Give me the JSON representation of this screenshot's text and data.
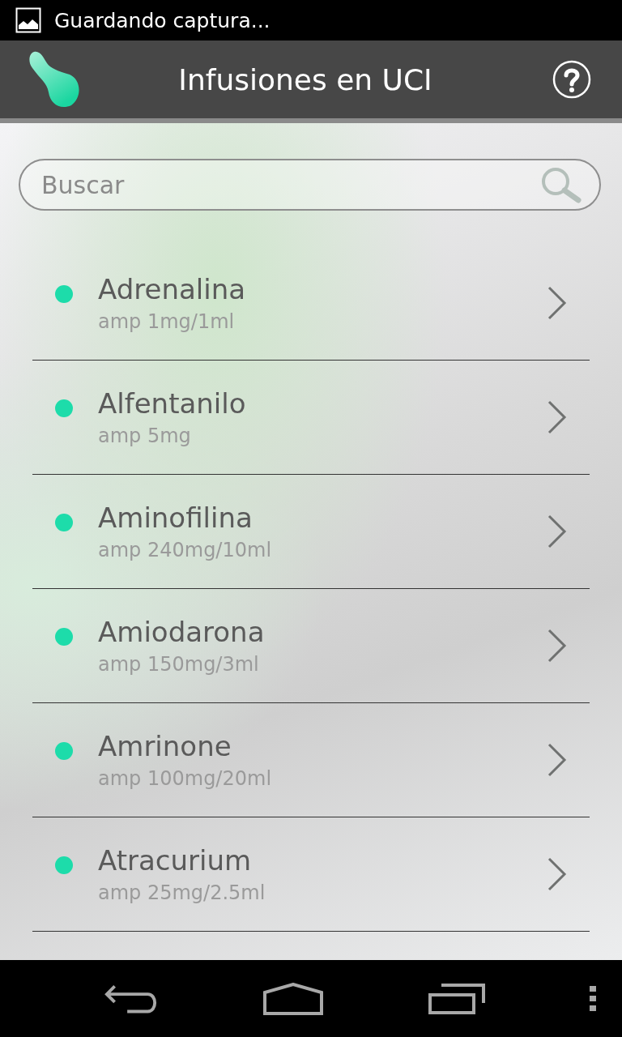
{
  "status_bar": {
    "notification": "Guardando captura..."
  },
  "action_bar": {
    "title": "Infusiones en UCI"
  },
  "search": {
    "placeholder": "Buscar"
  },
  "drugs": [
    {
      "name": "Adrenalina",
      "detail": "amp 1mg/1ml"
    },
    {
      "name": "Alfentanilo",
      "detail": "amp 5mg"
    },
    {
      "name": "Aminofilina",
      "detail": "amp 240mg/10ml"
    },
    {
      "name": "Amiodarona",
      "detail": "amp 150mg/3ml"
    },
    {
      "name": "Amrinone",
      "detail": "amp 100mg/20ml"
    },
    {
      "name": "Atracurium",
      "detail": "amp 25mg/2.5ml"
    }
  ]
}
